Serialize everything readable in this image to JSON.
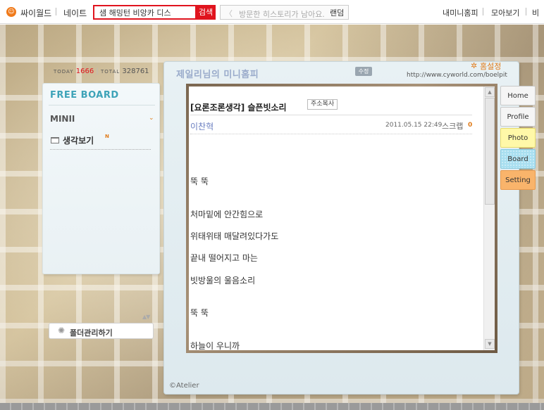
{
  "topbar": {
    "brand": "싸이월드",
    "nate": "네이트",
    "search_value": "샘 해밍턴 비앙카 디스",
    "search_button": "검색",
    "history_prev": "〈",
    "history_placeholder": "방문한 히스토리가 남아요.",
    "history_next": "〉",
    "random": "랜덤",
    "my_minihome": "내미니홈피",
    "collect": "모아보기",
    "cut_item": "비"
  },
  "stats": {
    "today_label": "TODAY",
    "today_count": "1666",
    "total_label": "TOTAL",
    "total_count": "328761"
  },
  "left_panel": {
    "board_title": "FREE BOARD",
    "category": "MINII",
    "category_chevron": "⌄",
    "folder_label": "생각보기",
    "new_badge": "N",
    "manage_button": "폴더관리하기",
    "collapse_arrows": "▲▼"
  },
  "main": {
    "home_settings_symbol": "✲",
    "home_settings_label": "홈설정",
    "site_title": "제일리님의 미니홈피",
    "edit_badge": "수정",
    "site_url": "http://www.cyworld.com/boelpit",
    "atelier": "©Atelier"
  },
  "post": {
    "title": "[요론조론생각] 슬픈빗소리",
    "copy_address": "주소복사",
    "author": "이찬혁",
    "date": "2011.05.15 22:49",
    "scrap_label": "스크랩",
    "scrap_count": "0",
    "lines": [
      "뚝 뚝",
      "처마밑에 안간힘으로",
      "위태위태 매달려있다가도",
      "끝내 떨어지고 마는",
      "빗방울의 울음소리",
      "뚝 뚝",
      "하늘이 우니까"
    ]
  },
  "side_tabs": {
    "home": "Home",
    "profile": "Profile",
    "photo": "Photo",
    "board": "Board",
    "setting": "Setting"
  },
  "colors": {
    "accent_red": "#e0141e",
    "accent_orange": "#e07b1a",
    "board_title_teal": "#3da3b8"
  }
}
